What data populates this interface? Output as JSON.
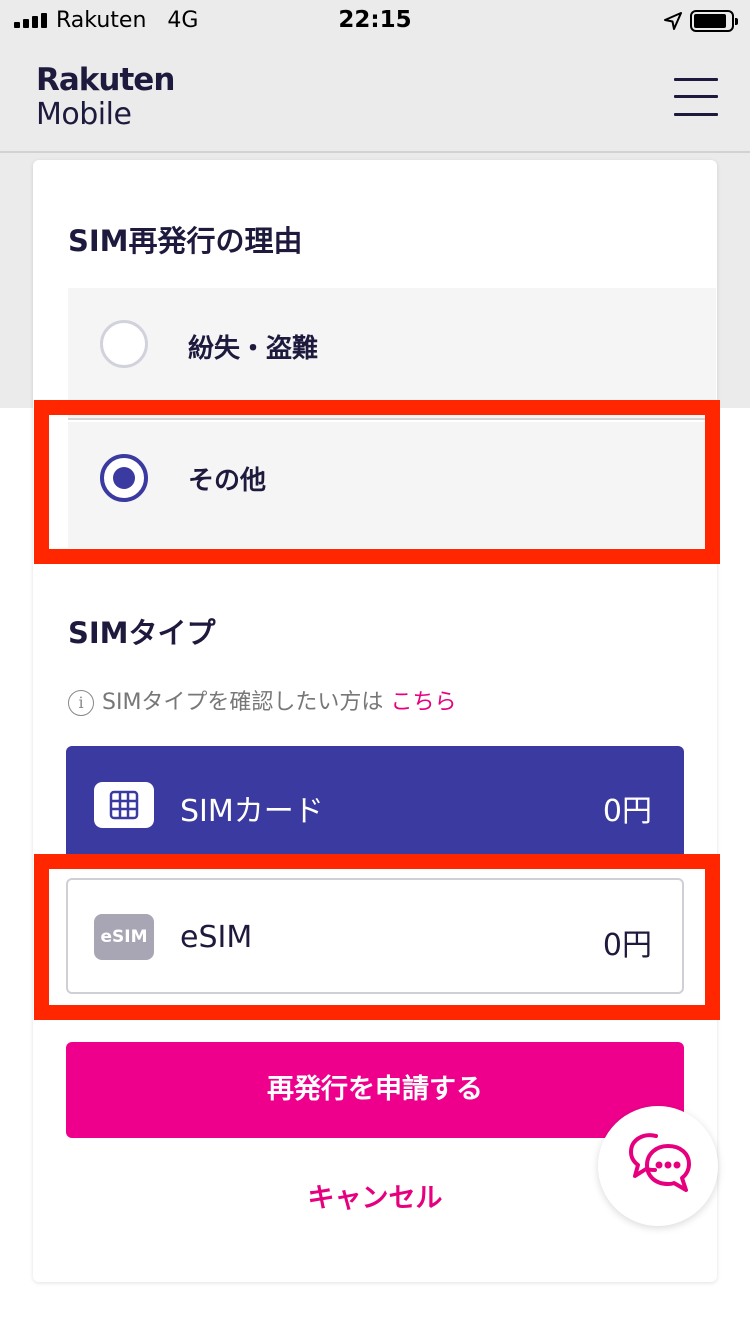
{
  "status_bar": {
    "carrier": "Rakuten",
    "network": "4G",
    "time": "22:15"
  },
  "header": {
    "logo_top": "Rakuten",
    "logo_bottom": "Mobile"
  },
  "reason_section": {
    "title": "SIM再発行の理由",
    "options": [
      {
        "label": "紛失・盗難",
        "selected": false
      },
      {
        "label": "その他",
        "selected": true
      }
    ]
  },
  "sim_type_section": {
    "title": "SIMタイプ",
    "info_text": "SIMタイプを確認したい方は",
    "info_link": "こちら",
    "info_icon": "i",
    "options": [
      {
        "name": "SIMカード",
        "price": "0円",
        "selected": true,
        "icon": "sim-card-icon"
      },
      {
        "name": "eSIM",
        "price": "0円",
        "selected": false,
        "icon": "esim-icon",
        "icon_text": "eSIM"
      }
    ]
  },
  "actions": {
    "submit_label": "再発行を申請する",
    "cancel_label": "キャンセル"
  },
  "colors": {
    "accent_pink": "#ef008c",
    "selected_purple": "#3a3aa0",
    "highlight_red": "#ff2600",
    "text_navy": "#1d1a3d"
  }
}
